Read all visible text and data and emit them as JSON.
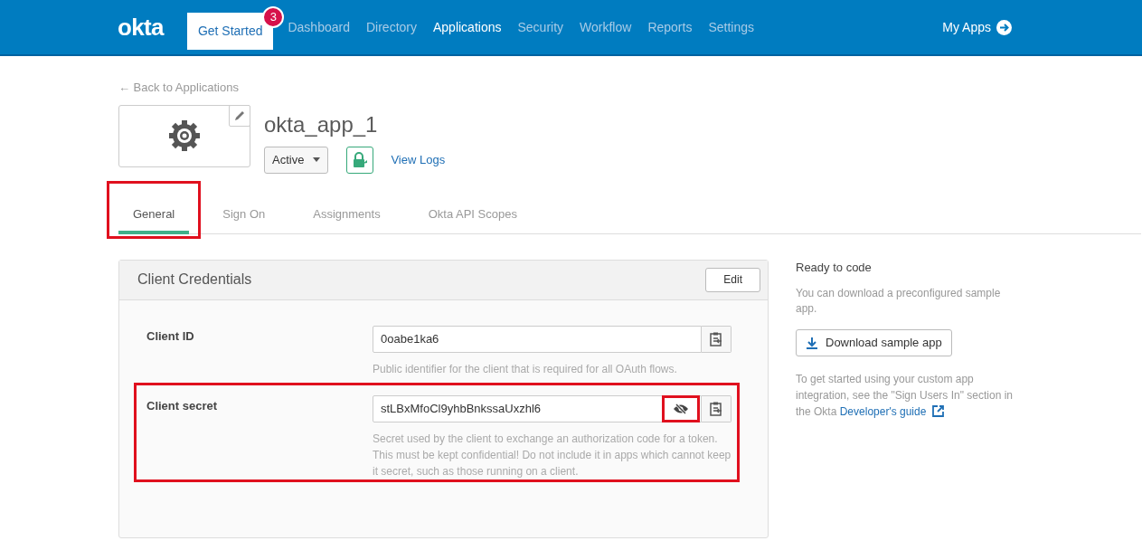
{
  "nav": {
    "logo": "okta",
    "items": [
      {
        "label": "Get Started",
        "kind": "button",
        "badge": "3"
      },
      {
        "label": "Dashboard",
        "kind": "link",
        "selected": false
      },
      {
        "label": "Directory",
        "kind": "link",
        "selected": false
      },
      {
        "label": "Applications",
        "kind": "link",
        "selected": true
      },
      {
        "label": "Security",
        "kind": "link",
        "selected": false
      },
      {
        "label": "Workflow",
        "kind": "link",
        "selected": false
      },
      {
        "label": "Reports",
        "kind": "link",
        "selected": false
      },
      {
        "label": "Settings",
        "kind": "link",
        "selected": false
      }
    ],
    "my_apps": "My Apps"
  },
  "back_link": "← Back to Applications",
  "app": {
    "name": "okta_app_1",
    "status": "Active",
    "view_logs": "View Logs"
  },
  "tabs": [
    {
      "label": "General",
      "selected": true,
      "highlighted": true
    },
    {
      "label": "Sign On",
      "selected": false,
      "highlighted": false
    },
    {
      "label": "Assignments",
      "selected": false,
      "highlighted": false
    },
    {
      "label": "Okta API Scopes",
      "selected": false,
      "highlighted": false
    }
  ],
  "credentials": {
    "title": "Client Credentials",
    "edit": "Edit",
    "fields": [
      {
        "label": "Client ID",
        "value": "0oabe1ka6",
        "help": "Public identifier for the client that is required for all OAuth flows.",
        "highlighted": false
      },
      {
        "label": "Client secret",
        "value": "stLBxMfoCl9yhbBnkssaUxzhl6",
        "help": "Secret used by the client to exchange an authorization code for a token. This must be kept confidential! Do not include it in apps which cannot keep it secret, such as those running on a client.",
        "highlighted": true,
        "reveal_button": {
          "highlighted": true
        }
      }
    ]
  },
  "side": {
    "title": "Ready to code",
    "text": "You can download a preconfigured sample app.",
    "button": "Download sample app",
    "note": "To get started using your custom app integration, see the \"Sign Users In\" section in the Okta",
    "link": "Developer's guide"
  }
}
